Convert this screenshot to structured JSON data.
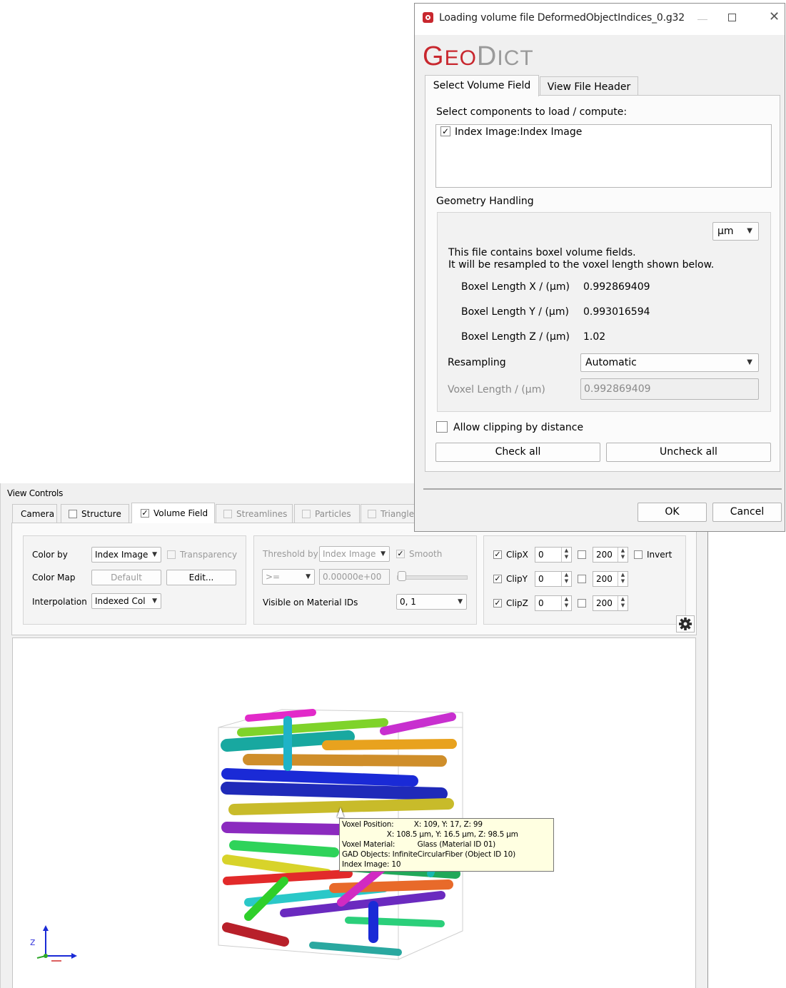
{
  "view_controls": {
    "title": "View Controls",
    "tabs": [
      {
        "label": "Camera",
        "checkbox": null,
        "enabled": true,
        "active": false
      },
      {
        "label": "Structure",
        "checkbox": false,
        "enabled": true,
        "active": false
      },
      {
        "label": "Volume Field",
        "checkbox": true,
        "enabled": true,
        "active": true
      },
      {
        "label": "Streamlines",
        "checkbox": false,
        "enabled": false,
        "active": false
      },
      {
        "label": "Particles",
        "checkbox": false,
        "enabled": false,
        "active": false
      },
      {
        "label": "Triangle",
        "checkbox": false,
        "enabled": false,
        "active": false
      }
    ],
    "color_group": {
      "color_by_label": "Color by",
      "color_by_value": "Index Image",
      "transparency_label": "Transparency",
      "color_map_label": "Color Map",
      "color_map_value": "Default",
      "edit_label": "Edit...",
      "interpolation_label": "Interpolation",
      "interpolation_value": "Indexed Col"
    },
    "threshold_group": {
      "threshold_label": "Threshold by",
      "threshold_value": "Index Image",
      "smooth_label": "Smooth",
      "operator_value": ">=",
      "threshold_number": "0.00000e+00",
      "visible_label": "Visible on Material IDs",
      "visible_value": "0, 1"
    },
    "clip_group": {
      "rows": [
        {
          "label": "ClipX",
          "min": "0",
          "max": "200"
        },
        {
          "label": "ClipY",
          "min": "0",
          "max": "200"
        },
        {
          "label": "ClipZ",
          "min": "0",
          "max": "200"
        }
      ],
      "invert_label": "Invert"
    },
    "tooltip": {
      "line1": "Voxel Position:         X: 109, Y: 17, Z: 99",
      "line2": "                    X: 108.5 µm, Y: 16.5 µm, Z: 98.5 µm",
      "line3": "Voxel Material:          Glass (Material ID 01)",
      "line4": "GAD Objects: InfiniteCircularFiber (Object ID 10)",
      "line5": "Index Image: 10"
    }
  },
  "dialog": {
    "title": "Loading volume file DeformedObjectIndices_0.g32",
    "logo_big1": "G",
    "logo_small1": "EO",
    "logo_big2": "D",
    "logo_small2": "ICT",
    "tabs": [
      "Select Volume Field",
      "View File Header"
    ],
    "select_label": "Select components to load / compute:",
    "component": "Index Image:Index Image",
    "geometry_label": "Geometry Handling",
    "unit_value": "µm",
    "info_line1": "This file contains boxel volume fields.",
    "info_line2": "It will be resampled to the voxel length shown below.",
    "boxel": [
      {
        "label": "Boxel Length X / (µm)",
        "value": "0.992869409"
      },
      {
        "label": "Boxel Length Y / (µm)",
        "value": "0.993016594"
      },
      {
        "label": "Boxel Length Z / (µm)",
        "value": "1.02"
      }
    ],
    "resampling_label": "Resampling",
    "resampling_value": "Automatic",
    "voxel_label": "Voxel Length / (µm)",
    "voxel_value": "0.992869409",
    "allow_clipping_label": "Allow clipping by distance",
    "check_all": "Check all",
    "uncheck_all": "Uncheck all",
    "ok": "OK",
    "cancel": "Cancel"
  },
  "colors": {
    "brand_red": "#c8272e"
  }
}
